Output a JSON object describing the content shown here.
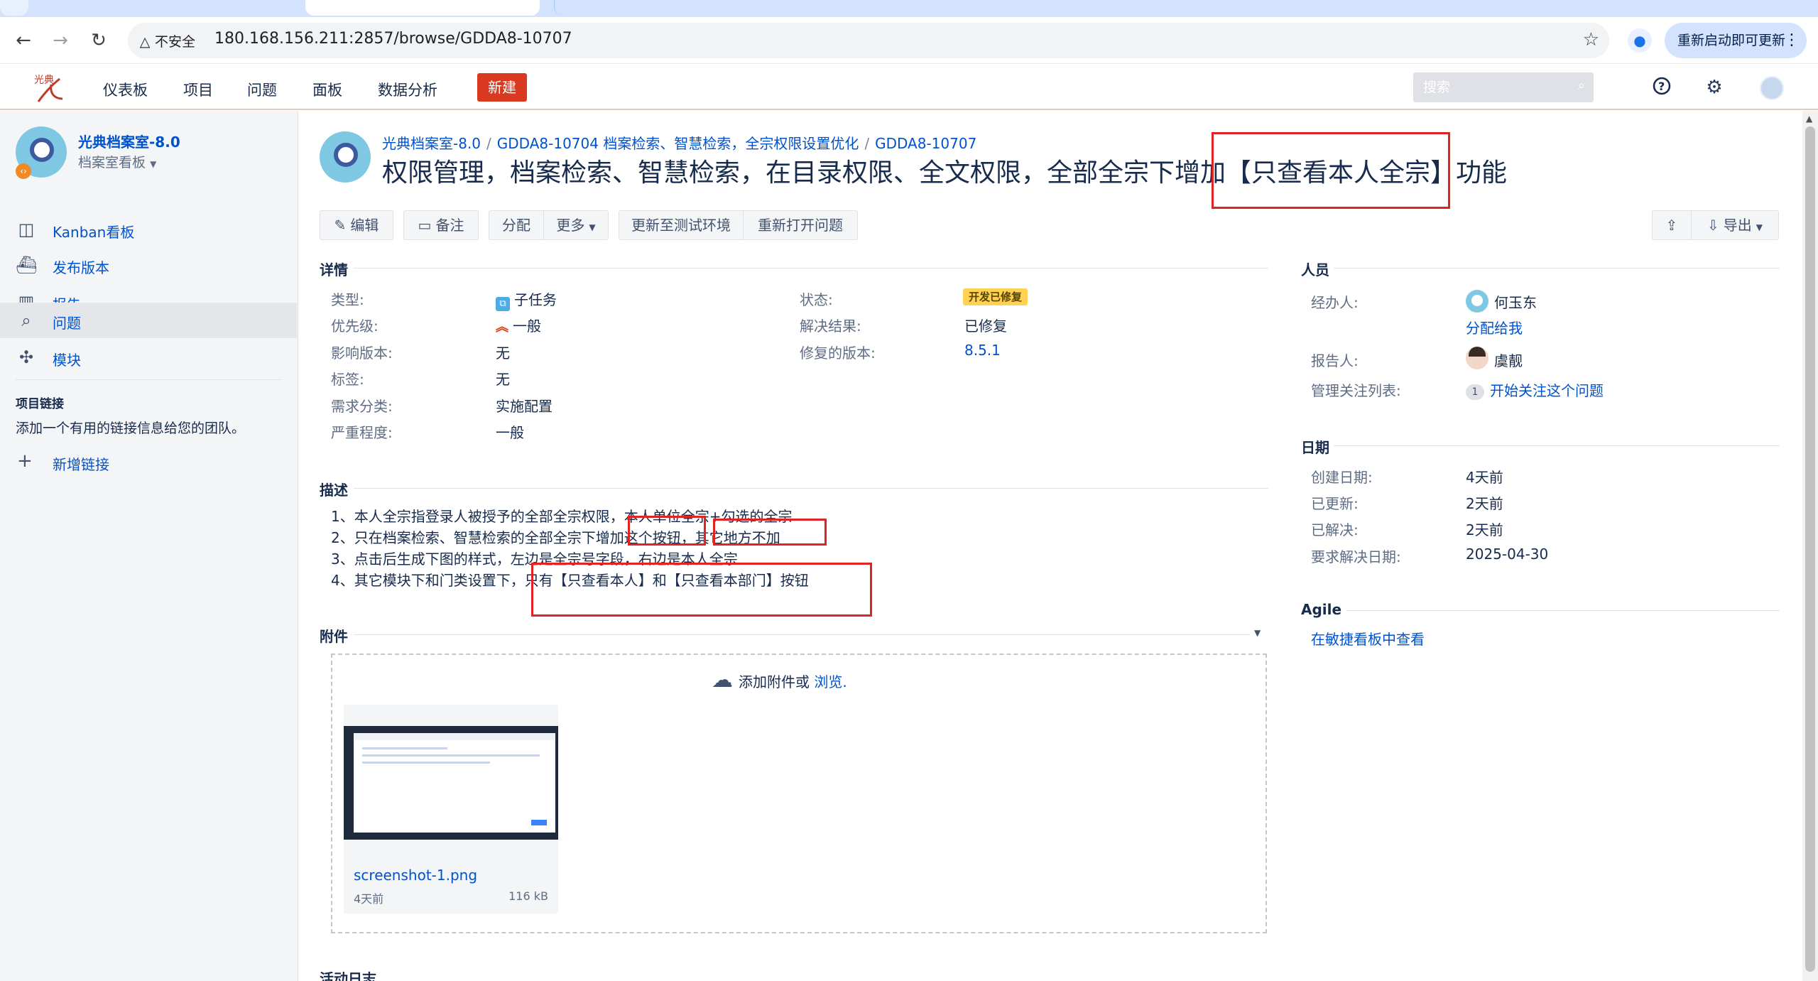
{
  "browser": {
    "security_label": "不安全",
    "url": "180.168.156.211:2857/browse/GDDA8-10707",
    "update_label": "重新启动即可更新"
  },
  "header": {
    "nav": [
      "仪表板",
      "项目",
      "问题",
      "面板",
      "数据分析"
    ],
    "create_label": "新建",
    "search_placeholder": "搜索"
  },
  "sidebar": {
    "project_name": "光典档案室-8.0",
    "board_name": "档案室看板",
    "items": [
      {
        "label": "Kanban看板",
        "icon": "board-icon"
      },
      {
        "label": "发布版本",
        "icon": "ship-icon"
      },
      {
        "label": "报告",
        "icon": "chart-icon"
      },
      {
        "label": "问题",
        "icon": "issues-icon"
      },
      {
        "label": "模块",
        "icon": "puzzle-icon"
      }
    ],
    "links_title": "项目链接",
    "links_desc": "添加一个有用的链接信息给您的团队。",
    "add_link": "新增链接"
  },
  "issue": {
    "breadcrumb": [
      "光典档案室-8.0",
      "GDDA8-10704 档案检索、智慧检索，全宗权限设置优化",
      "GDDA8-10707"
    ],
    "summary": "权限管理，档案检索、智慧检索，在目录权限、全文权限，全部全宗下增加【只查看本人全宗】功能"
  },
  "toolbar": {
    "edit": "编辑",
    "comment": "备注",
    "assign": "分配",
    "more": "更多",
    "to_test": "更新至测试环境",
    "reopen": "重新打开问题",
    "export": "导出"
  },
  "details": {
    "title": "详情",
    "type_label": "类型:",
    "type_value": "子任务",
    "priority_label": "优先级:",
    "priority_value": "一般",
    "affects_label": "影响版本:",
    "affects_value": "无",
    "labels_label": "标签:",
    "labels_value": "无",
    "req_label": "需求分类:",
    "req_value": "实施配置",
    "severity_label": "严重程度:",
    "severity_value": "一般",
    "status_label": "状态:",
    "status_value": "开发已修复",
    "resolution_label": "解决结果:",
    "resolution_value": "已修复",
    "fixver_label": "修复的版本:",
    "fixver_value": "8.5.1"
  },
  "description": {
    "title": "描述",
    "lines": [
      "1、本人全宗指登录人被授予的全部全宗权限，本人单位全宗+勾选的全宗",
      "2、只在档案检索、智慧检索的全部全宗下增加这个按钮，其它地方不加",
      "3、点击后生成下图的样式，左边是全宗号字段，右边是本人全宗",
      "4、其它模块下和门类设置下，只有【只查看本人】和【只查看本部门】按钮"
    ]
  },
  "attachments": {
    "title": "附件",
    "drop_text": "添加附件或",
    "browse": "浏览.",
    "file": {
      "name": "screenshot-1.png",
      "date": "4天前",
      "size": "116 kB"
    }
  },
  "people": {
    "title": "人员",
    "assignee_label": "经办人:",
    "assignee": "何玉东",
    "assign_me": "分配给我",
    "reporter_label": "报告人:",
    "reporter": "虞靓",
    "watchers_label": "管理关注列表:",
    "watch_count": "1",
    "watch_link": "开始关注这个问题"
  },
  "dates": {
    "title": "日期",
    "created_label": "创建日期:",
    "created": "4天前",
    "updated_label": "已更新:",
    "updated": "2天前",
    "resolved_label": "已解决:",
    "resolved": "2天前",
    "due_label": "要求解决日期:",
    "due": "2025-04-30"
  },
  "agile": {
    "title": "Agile",
    "link": "在敏捷看板中查看"
  },
  "activity": {
    "title": "活动日志"
  },
  "colors": {
    "accent": "#0052cc",
    "create": "#d93a1f",
    "status_bg": "#ffd351",
    "annotation": "#e02424"
  }
}
